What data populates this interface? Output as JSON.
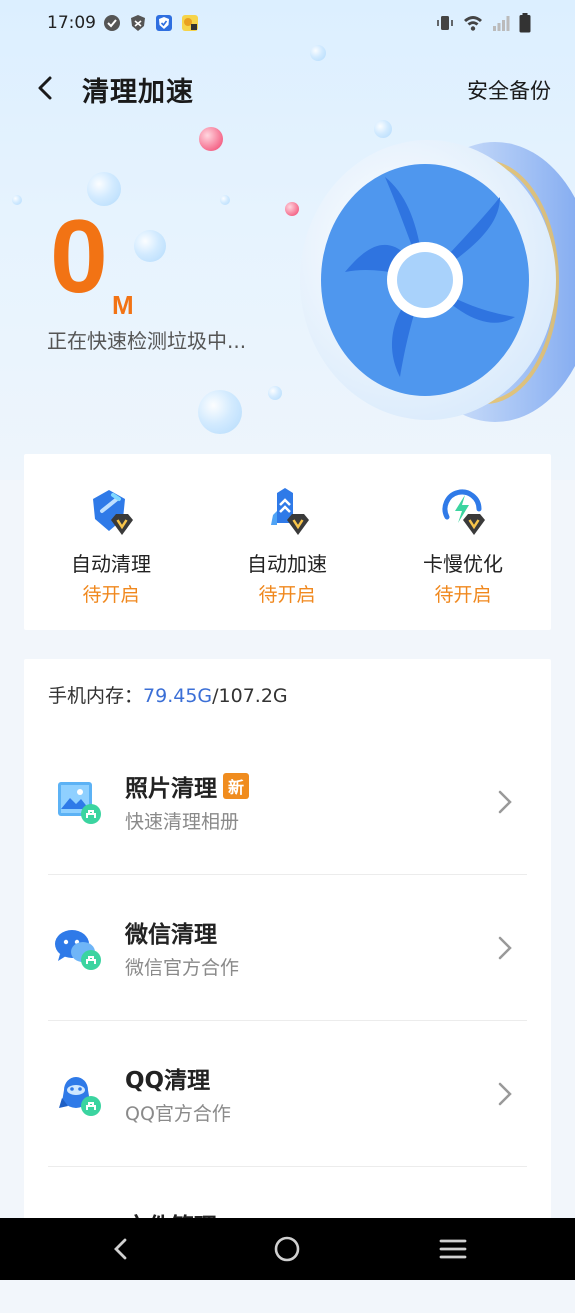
{
  "status_bar": {
    "time": "17:09"
  },
  "header": {
    "title": "清理加速",
    "backup_label": "安全备份"
  },
  "scan": {
    "size_value": "0",
    "size_unit": "M",
    "status_text": "正在快速检测垃圾中..."
  },
  "features": [
    {
      "name": "自动清理",
      "status": "待开启",
      "icon": "broom-shield-icon"
    },
    {
      "name": "自动加速",
      "status": "待开启",
      "icon": "rocket-shield-icon"
    },
    {
      "name": "卡慢优化",
      "status": "待开启",
      "icon": "lightning-gauge-icon"
    }
  ],
  "storage": {
    "label": "手机内存：",
    "used": "79.45G",
    "total": "/107.2G"
  },
  "clean_items": [
    {
      "title": "照片清理",
      "badge": "新",
      "subtitle": "快速清理相册",
      "icon": "photo-clean-icon"
    },
    {
      "title": "微信清理",
      "subtitle": "微信官方合作",
      "icon": "wechat-clean-icon"
    },
    {
      "title": "QQ清理",
      "subtitle": "QQ官方合作",
      "icon": "qq-clean-icon"
    },
    {
      "title": "文件管理",
      "subtitle": "",
      "icon": "file-manage-icon"
    }
  ],
  "colors": {
    "accent_orange": "#f27314",
    "status_orange": "#f0881e",
    "link_blue": "#3b6fd6",
    "badge_orange": "#f08c1e"
  }
}
